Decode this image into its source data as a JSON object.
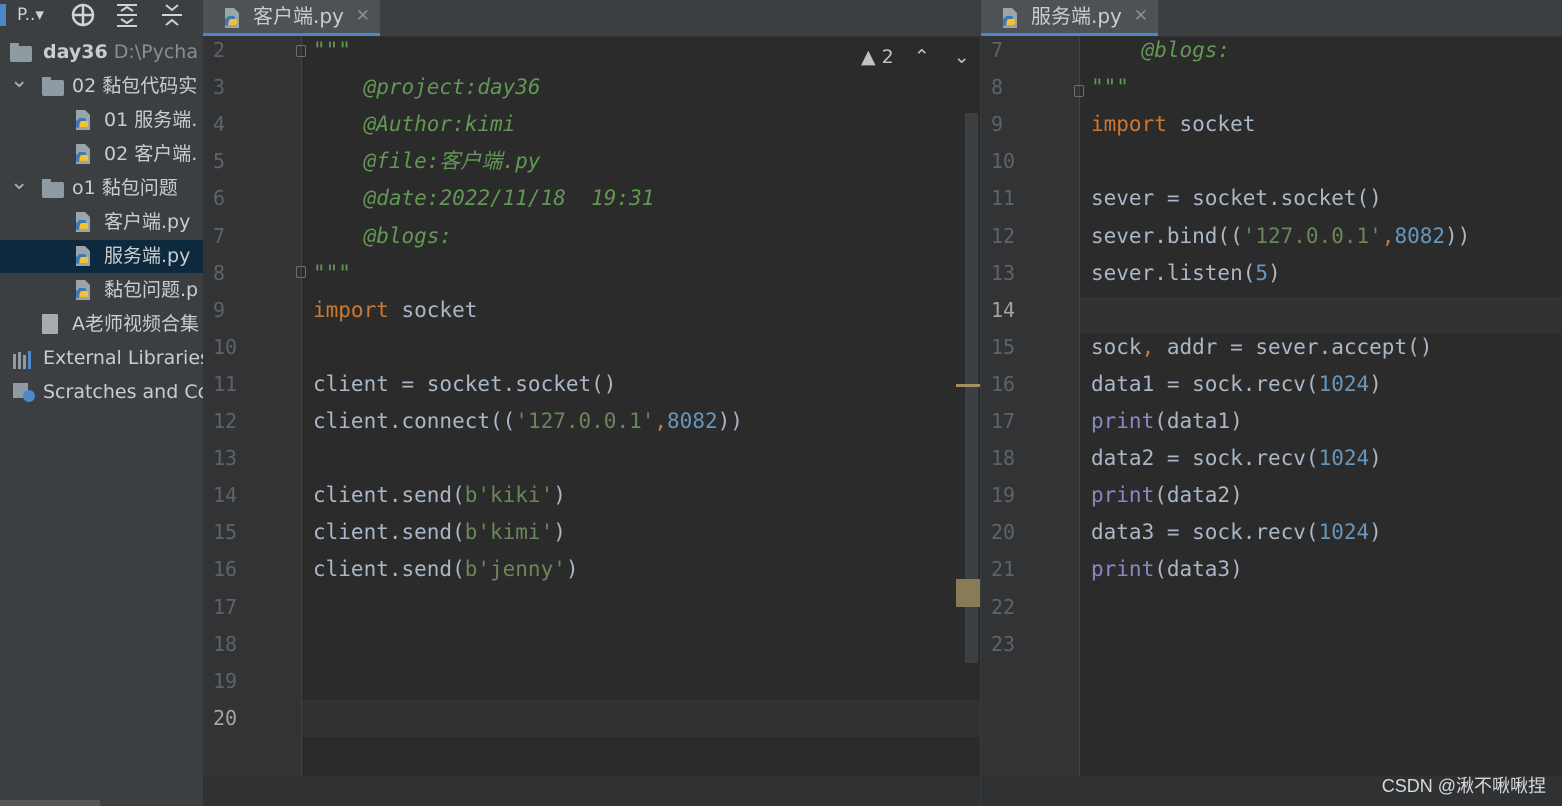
{
  "sidebar": {
    "toolbar": {
      "project_label": "P..▾"
    },
    "tree": [
      {
        "label": "day36",
        "secondary": "D:\\Pycha",
        "kind": "folder",
        "depth": 0
      },
      {
        "label": "02 黏包代码实",
        "kind": "folder",
        "depth": 1,
        "expanded": true
      },
      {
        "label": "01 服务端.",
        "kind": "python-file",
        "depth": 2
      },
      {
        "label": "02 客户端.",
        "kind": "python-file",
        "depth": 2
      },
      {
        "label": "o1 黏包问题",
        "kind": "folder",
        "depth": 1,
        "expanded": true
      },
      {
        "label": "客户端.py",
        "kind": "python-file",
        "depth": 2
      },
      {
        "label": "服务端.py",
        "kind": "python-file",
        "depth": 2,
        "selected": true
      },
      {
        "label": "黏包问题.p",
        "kind": "python-file",
        "depth": 2
      },
      {
        "label": "A老师视频合集",
        "kind": "document-file",
        "depth": 1
      },
      {
        "label": "External Libraries",
        "kind": "library",
        "depth": 0
      },
      {
        "label": "Scratches and Co",
        "kind": "scratches",
        "depth": 0
      }
    ]
  },
  "left_editor": {
    "tab_title": "客户端.py",
    "inspection_count": "2",
    "line_numbers": [
      "2",
      "3",
      "4",
      "5",
      "6",
      "7",
      "8",
      "9",
      "10",
      "11",
      "12",
      "13",
      "14",
      "15",
      "16",
      "17",
      "18",
      "19",
      "20"
    ],
    "current_line": "20",
    "lines": [
      {
        "n": "2",
        "tokens": [
          {
            "t": "\"\"\"",
            "c": "doc"
          }
        ]
      },
      {
        "n": "3",
        "tokens": [
          {
            "t": "    @project:day36",
            "c": "doc"
          }
        ]
      },
      {
        "n": "4",
        "tokens": [
          {
            "t": "    @Author:kimi",
            "c": "doc"
          }
        ]
      },
      {
        "n": "5",
        "tokens": [
          {
            "t": "    @file:客户端.py",
            "c": "doc"
          }
        ]
      },
      {
        "n": "6",
        "tokens": [
          {
            "t": "    @date:2022/11/18  19:31",
            "c": "doc"
          }
        ]
      },
      {
        "n": "7",
        "tokens": [
          {
            "t": "    @blogs:",
            "c": "doc"
          }
        ]
      },
      {
        "n": "8",
        "tokens": [
          {
            "t": "\"\"\"",
            "c": "doc"
          }
        ]
      },
      {
        "n": "9",
        "tokens": [
          {
            "t": "import",
            "c": "kw"
          },
          {
            "t": " socket",
            "c": ""
          }
        ]
      },
      {
        "n": "10",
        "tokens": []
      },
      {
        "n": "11",
        "tokens": [
          {
            "t": "client = socket.socket()",
            "c": ""
          }
        ]
      },
      {
        "n": "12",
        "tokens": [
          {
            "t": "client.connect((",
            "c": ""
          },
          {
            "t": "'127.0.0.1'",
            "c": "str"
          },
          {
            "t": ",",
            "c": "punc"
          },
          {
            "t": "8082",
            "c": "num"
          },
          {
            "t": "))",
            "c": ""
          }
        ]
      },
      {
        "n": "13",
        "tokens": []
      },
      {
        "n": "14",
        "tokens": [
          {
            "t": "client.send(",
            "c": ""
          },
          {
            "t": "b'kiki'",
            "c": "str"
          },
          {
            "t": ")",
            "c": ""
          }
        ]
      },
      {
        "n": "15",
        "tokens": [
          {
            "t": "client.send(",
            "c": ""
          },
          {
            "t": "b'kimi'",
            "c": "str"
          },
          {
            "t": ")",
            "c": ""
          }
        ]
      },
      {
        "n": "16",
        "tokens": [
          {
            "t": "client.send(",
            "c": ""
          },
          {
            "t": "b'jenny'",
            "c": "str"
          },
          {
            "t": ")",
            "c": ""
          }
        ]
      },
      {
        "n": "17",
        "tokens": []
      },
      {
        "n": "18",
        "tokens": []
      },
      {
        "n": "19",
        "tokens": []
      },
      {
        "n": "20",
        "tokens": []
      }
    ]
  },
  "right_editor": {
    "tab_title": "服务端.py",
    "line_numbers": [
      "7",
      "8",
      "9",
      "10",
      "11",
      "12",
      "13",
      "14",
      "15",
      "16",
      "17",
      "18",
      "19",
      "20",
      "21",
      "22",
      "23"
    ],
    "current_line": "14",
    "lines": [
      {
        "n": "7",
        "tokens": [
          {
            "t": "    @blogs:",
            "c": "doc"
          }
        ]
      },
      {
        "n": "8",
        "tokens": [
          {
            "t": "\"\"\"",
            "c": "doc"
          }
        ]
      },
      {
        "n": "9",
        "tokens": [
          {
            "t": "import",
            "c": "kw"
          },
          {
            "t": " socket",
            "c": ""
          }
        ]
      },
      {
        "n": "10",
        "tokens": []
      },
      {
        "n": "11",
        "tokens": [
          {
            "t": "sever = socket.socket()",
            "c": ""
          }
        ]
      },
      {
        "n": "12",
        "tokens": [
          {
            "t": "sever.bind((",
            "c": ""
          },
          {
            "t": "'127.0.0.1'",
            "c": "str"
          },
          {
            "t": ",",
            "c": "punc"
          },
          {
            "t": "8082",
            "c": "num"
          },
          {
            "t": "))",
            "c": ""
          }
        ]
      },
      {
        "n": "13",
        "tokens": [
          {
            "t": "sever.listen(",
            "c": ""
          },
          {
            "t": "5",
            "c": "num"
          },
          {
            "t": ")",
            "c": ""
          }
        ]
      },
      {
        "n": "14",
        "tokens": []
      },
      {
        "n": "15",
        "tokens": [
          {
            "t": "sock",
            "c": ""
          },
          {
            "t": ",",
            "c": "punc"
          },
          {
            "t": " addr = sever.accept()",
            "c": ""
          }
        ]
      },
      {
        "n": "16",
        "tokens": [
          {
            "t": "data1 = sock.recv(",
            "c": ""
          },
          {
            "t": "1024",
            "c": "num"
          },
          {
            "t": ")",
            "c": ""
          }
        ]
      },
      {
        "n": "17",
        "tokens": [
          {
            "t": "print",
            "c": "bi"
          },
          {
            "t": "(data1)",
            "c": ""
          }
        ]
      },
      {
        "n": "18",
        "tokens": [
          {
            "t": "data2 = sock.recv(",
            "c": ""
          },
          {
            "t": "1024",
            "c": "num"
          },
          {
            "t": ")",
            "c": ""
          }
        ]
      },
      {
        "n": "19",
        "tokens": [
          {
            "t": "print",
            "c": "bi"
          },
          {
            "t": "(data2)",
            "c": ""
          }
        ]
      },
      {
        "n": "20",
        "tokens": [
          {
            "t": "data3 = sock.recv(",
            "c": ""
          },
          {
            "t": "1024",
            "c": "num"
          },
          {
            "t": ")",
            "c": ""
          }
        ]
      },
      {
        "n": "21",
        "tokens": [
          {
            "t": "print",
            "c": "bi"
          },
          {
            "t": "(data3)",
            "c": ""
          }
        ]
      },
      {
        "n": "22",
        "tokens": []
      },
      {
        "n": "23",
        "tokens": []
      }
    ]
  },
  "watermark": "CSDN @湫不啾啾捏",
  "colors": {
    "keyword": "#cc7832",
    "string": "#6a8759",
    "number": "#6897bb",
    "docstring": "#629755",
    "builtin": "#8888c6",
    "text": "#a9b7c6"
  }
}
